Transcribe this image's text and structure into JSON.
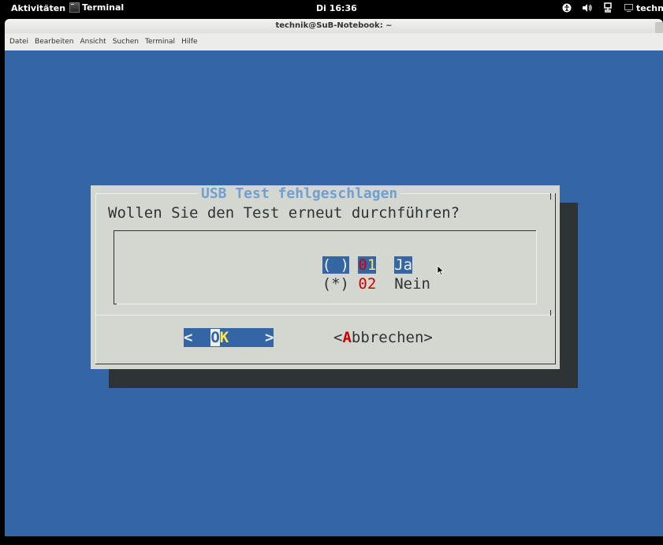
{
  "topbar": {
    "activities": "Aktivitäten",
    "app_name": "Terminal",
    "clock": "Di 16:36",
    "user": "techni"
  },
  "window": {
    "title": "technik@SuB-Notebook: ~"
  },
  "menu": [
    "Datei",
    "Bearbeiten",
    "Ansicht",
    "Suchen",
    "Terminal",
    "Hilfe"
  ],
  "dialog": {
    "title": "USB Test fehlgeschlagen",
    "question": "Wollen Sie den Test erneut durchführen?",
    "options": [
      {
        "mark": "( )",
        "tag_first": "0",
        "tag_rest": "1",
        "label": "Ja",
        "selected": true
      },
      {
        "mark": "(*)",
        "tag_first": "0",
        "tag_rest": "2",
        "label": "Nein",
        "selected": false
      }
    ],
    "ok_left": "<  ",
    "ok_o": "O",
    "ok_k": "K",
    "ok_right": "    >",
    "cancel_open": "<",
    "cancel_hot": "A",
    "cancel_rest": "bbrechen>"
  },
  "colors": {
    "terminal_bg": "#3465a4",
    "dialog_bg": "#d3d7cf",
    "title_color": "#729fcf",
    "hotkey": "#cc0000",
    "highlight_key": "#fce94f"
  }
}
